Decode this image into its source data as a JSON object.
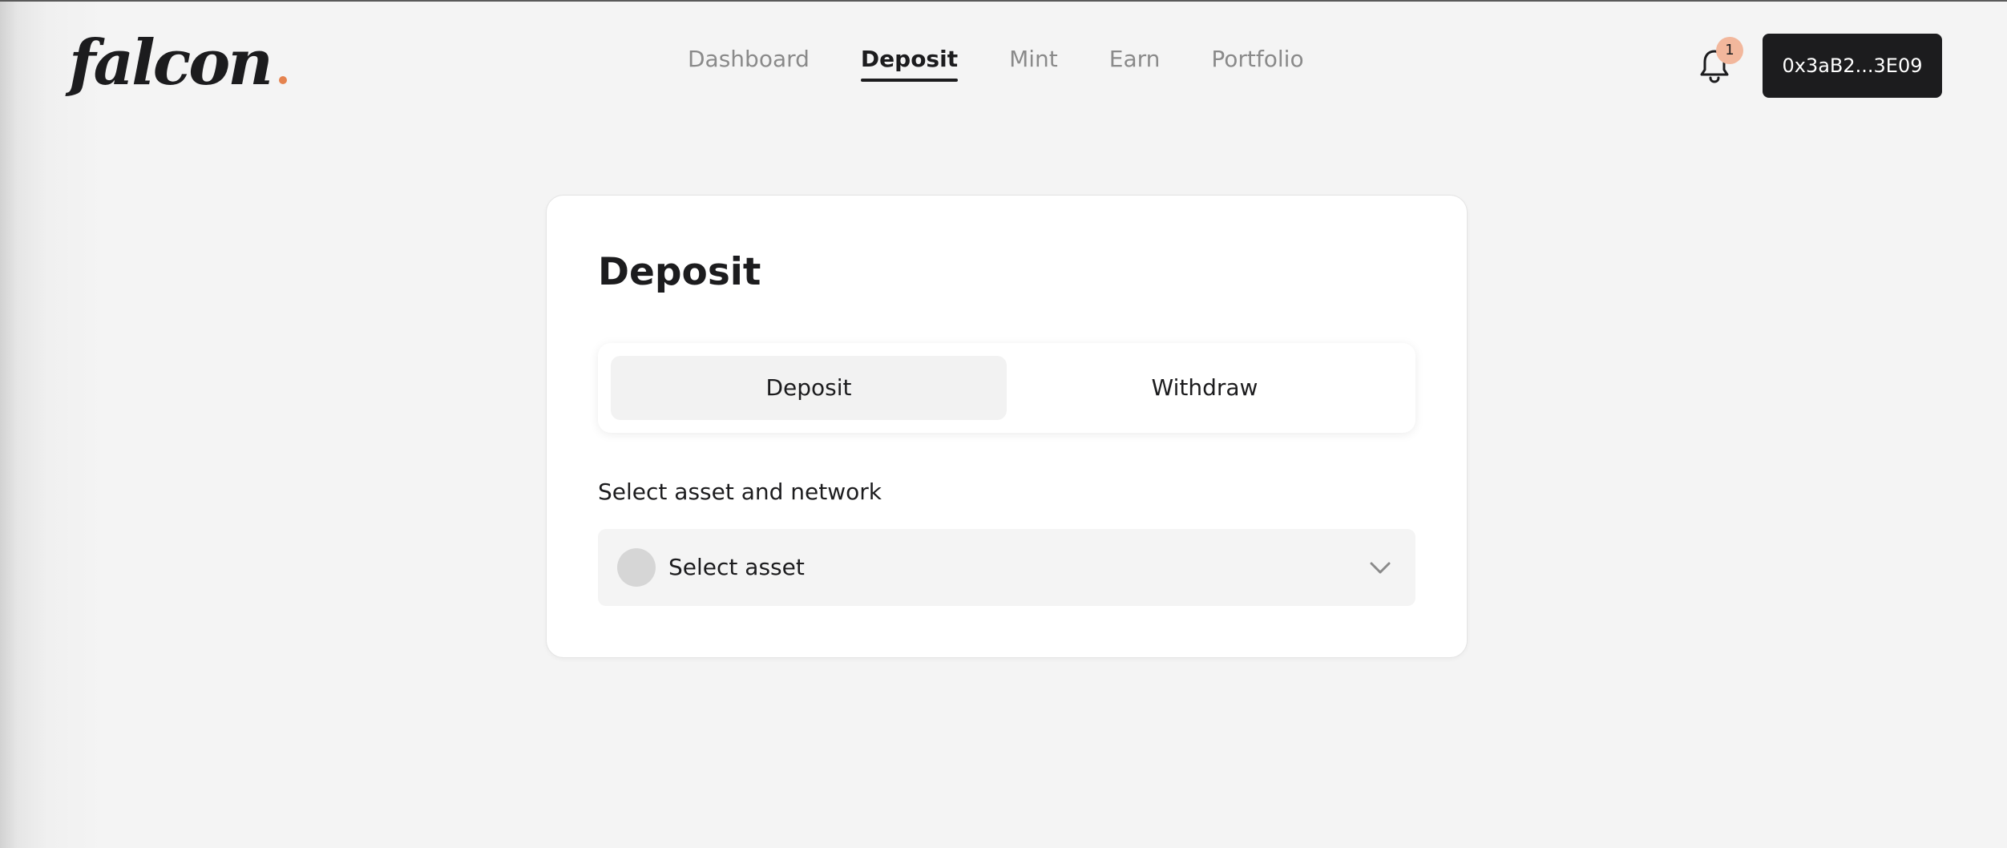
{
  "app": {
    "logo_text": "falcon",
    "accent_color": "#e5834f"
  },
  "nav": {
    "items": [
      {
        "label": "Dashboard",
        "active": false
      },
      {
        "label": "Deposit",
        "active": true
      },
      {
        "label": "Mint",
        "active": false
      },
      {
        "label": "Earn",
        "active": false
      },
      {
        "label": "Portfolio",
        "active": false
      }
    ]
  },
  "header": {
    "notification_icon": "bell-icon",
    "notification_count": "1",
    "wallet_address": "0x3aB2...3E09"
  },
  "card": {
    "title": "Deposit",
    "toggle": {
      "deposit_label": "Deposit",
      "withdraw_label": "Withdraw",
      "selected": "Deposit"
    },
    "asset_field": {
      "label": "Select asset and network",
      "placeholder": "Select asset",
      "chevron_icon": "chevron-down-icon"
    }
  }
}
